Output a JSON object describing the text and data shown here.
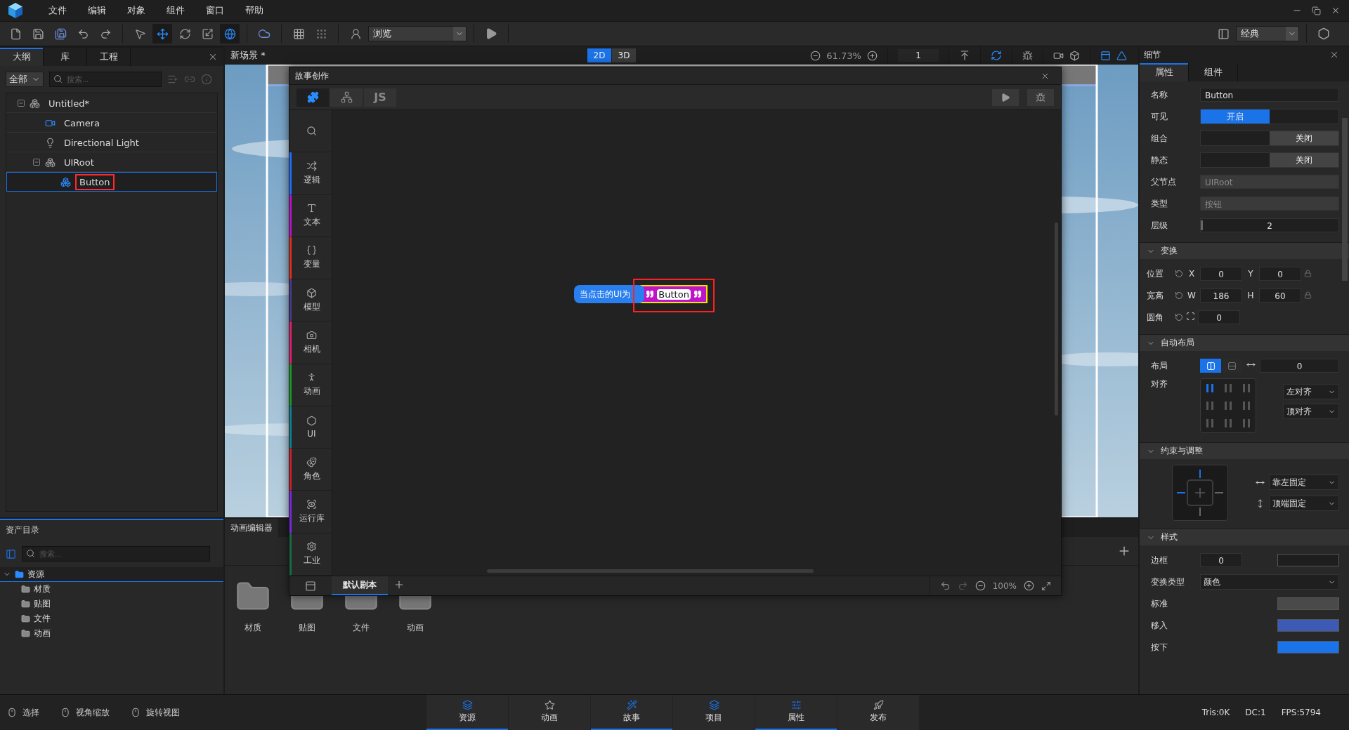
{
  "menu": [
    "文件",
    "编辑",
    "对象",
    "组件",
    "窗口",
    "帮助"
  ],
  "toolbar": {
    "tools": [
      {
        "kind": "select",
        "selected": false
      },
      {
        "kind": "move",
        "selected": true
      },
      {
        "kind": "rotate",
        "selected": false
      },
      {
        "kind": "scale",
        "selected": false
      },
      {
        "kind": "rect",
        "selected": true
      }
    ],
    "mode_select": "浏览",
    "layout_select": "经典"
  },
  "outline": {
    "tabs": [
      {
        "label": "大纲",
        "selected": true
      },
      {
        "label": "库",
        "selected": false
      },
      {
        "label": "工程",
        "selected": false
      }
    ],
    "filter": "全部",
    "search_placeholder": "搜索...",
    "tree": [
      {
        "label": "Untitled*",
        "kind": "scene",
        "expanded": true,
        "selected": false,
        "highlighted": false,
        "children": [
          {
            "label": "Camera",
            "kind": "camera",
            "selected": false,
            "highlighted": false
          },
          {
            "label": "Directional Light",
            "kind": "light",
            "selected": false,
            "highlighted": false
          },
          {
            "label": "UIRoot",
            "kind": "group",
            "expanded": true,
            "selected": false,
            "highlighted": false,
            "children": [
              {
                "label": "Button",
                "kind": "ui",
                "selected": true,
                "highlighted": true
              }
            ]
          }
        ]
      }
    ]
  },
  "scene": {
    "title": "新场景 *",
    "view_modes": [
      {
        "label": "2D",
        "selected": true
      },
      {
        "label": "3D",
        "selected": false
      }
    ],
    "zoom": "61.73%",
    "layer": "1"
  },
  "story": {
    "title": "故事创作",
    "tabs": [
      {
        "kind": "blocks",
        "selected": true
      },
      {
        "kind": "tree",
        "selected": false
      },
      {
        "kind": "code",
        "label": "JS",
        "selected": false
      }
    ],
    "categories": [
      {
        "kind": "search"
      },
      {
        "kind": "logic",
        "label": "逻辑",
        "color": "#1e6fff"
      },
      {
        "kind": "text",
        "label": "文本",
        "color": "#c010c8"
      },
      {
        "kind": "variable",
        "label": "变量",
        "color": "#e0301e"
      },
      {
        "kind": "model",
        "label": "模型",
        "color": "#4b3a8c"
      },
      {
        "kind": "camera",
        "label": "相机",
        "color": "#e0206e"
      },
      {
        "kind": "animation",
        "label": "动画",
        "color": "#189a26"
      },
      {
        "kind": "ui",
        "label": "UI",
        "color": "#108090"
      },
      {
        "kind": "role",
        "label": "角色",
        "color": "#d0202e"
      },
      {
        "kind": "runtime",
        "label": "运行库",
        "color": "#7a28e0"
      },
      {
        "kind": "industry",
        "label": "工业",
        "color": "#1a6a48"
      }
    ],
    "block": {
      "event": "当点击的UI为",
      "value": "Button",
      "highlighted": true
    },
    "script_tabs": [
      {
        "label": "默认剧本",
        "selected": true
      }
    ],
    "zoom": "100%"
  },
  "assets": {
    "title": "资产目录",
    "search_placeholder": "搜索...",
    "tree": [
      {
        "label": "资源",
        "selected": true,
        "expanded": true,
        "children": [
          {
            "label": "材质",
            "selected": false
          },
          {
            "label": "贴图",
            "selected": false
          },
          {
            "label": "文件",
            "selected": false
          },
          {
            "label": "动画",
            "selected": false
          }
        ]
      }
    ]
  },
  "anim_editor": {
    "title": "动画编辑器",
    "folders": [
      "材质",
      "贴图",
      "文件",
      "动画"
    ]
  },
  "details": {
    "title": "细节",
    "tabs": [
      {
        "label": "属性",
        "selected": true
      },
      {
        "label": "组件",
        "selected": false
      }
    ],
    "props": [
      {
        "kind": "text",
        "label": "名称",
        "value": "Button",
        "disabled": false
      },
      {
        "kind": "toggle",
        "label": "可见",
        "value": "开启",
        "on": true,
        "disabled": false
      },
      {
        "kind": "toggle",
        "label": "组合",
        "value": "关闭",
        "on": false,
        "disabled": false
      },
      {
        "kind": "toggle",
        "label": "静态",
        "value": "关闭",
        "on": false,
        "disabled": false
      },
      {
        "kind": "text",
        "label": "父节点",
        "value": "UIRoot",
        "disabled": true
      },
      {
        "kind": "text",
        "label": "类型",
        "value": "按钮",
        "disabled": true
      },
      {
        "kind": "number",
        "label": "层级",
        "value": "2",
        "disabled": false
      }
    ],
    "transform": {
      "title": "变换",
      "expanded": true,
      "rows": [
        {
          "kind": "pair",
          "label": "位置",
          "fields": [
            {
              "axis": "X",
              "value": "0"
            },
            {
              "axis": "Y",
              "value": "0"
            }
          ]
        },
        {
          "kind": "pair",
          "label": "宽高",
          "fields": [
            {
              "axis": "W",
              "value": "186"
            },
            {
              "axis": "H",
              "value": "60"
            }
          ]
        },
        {
          "kind": "radius",
          "label": "圆角",
          "fields": [
            {
              "value": "0"
            }
          ]
        }
      ]
    },
    "auto_layout": {
      "title": "自动布局",
      "expanded": true,
      "layout_label": "布局",
      "directions": [
        {
          "kind": "horizontal",
          "selected": true
        },
        {
          "kind": "vertical",
          "selected": false
        }
      ],
      "spacing": "0",
      "align_label": "对齐",
      "align_cells": [
        {
          "selected": true
        },
        {
          "selected": false
        },
        {
          "selected": false
        },
        {
          "selected": false
        },
        {
          "selected": false
        },
        {
          "selected": false
        },
        {
          "selected": false
        },
        {
          "selected": false
        },
        {
          "selected": false
        }
      ],
      "h_align": "左对齐",
      "v_align": "顶对齐"
    },
    "constraints": {
      "title": "约束与调整",
      "expanded": true,
      "anchors": [
        {
          "kind": "top",
          "active": true
        },
        {
          "kind": "left",
          "active": true
        },
        {
          "kind": "right",
          "active": false
        },
        {
          "kind": "bottom",
          "active": false
        }
      ],
      "h": "靠左固定",
      "v": "顶端固定"
    },
    "style": {
      "title": "样式",
      "expanded": true,
      "rows": [
        {
          "kind": "border",
          "label": "边框",
          "value": "0",
          "color": "#1e1e1e"
        },
        {
          "kind": "select",
          "label": "变换类型",
          "value": "颜色"
        },
        {
          "kind": "swatch",
          "label": "标准",
          "color": "#4a4a4a"
        },
        {
          "kind": "swatch",
          "label": "移入",
          "color": "#3d5bb5"
        },
        {
          "kind": "swatch",
          "label": "按下",
          "color": "#1a73e8"
        }
      ]
    }
  },
  "status_bar": {
    "hints": [
      "选择",
      "视角缩放",
      "旋转视图"
    ],
    "nav": [
      {
        "kind": "assets",
        "label": "资源",
        "selected": true
      },
      {
        "kind": "animation",
        "label": "动画",
        "selected": false
      },
      {
        "kind": "story",
        "label": "故事",
        "selected": true
      },
      {
        "kind": "project",
        "label": "项目",
        "selected": false
      },
      {
        "kind": "properties",
        "label": "属性",
        "selected": true
      },
      {
        "kind": "publish",
        "label": "发布",
        "selected": false
      }
    ],
    "stats": [
      "Tris:0K",
      "DC:1",
      "FPS:5794"
    ]
  }
}
